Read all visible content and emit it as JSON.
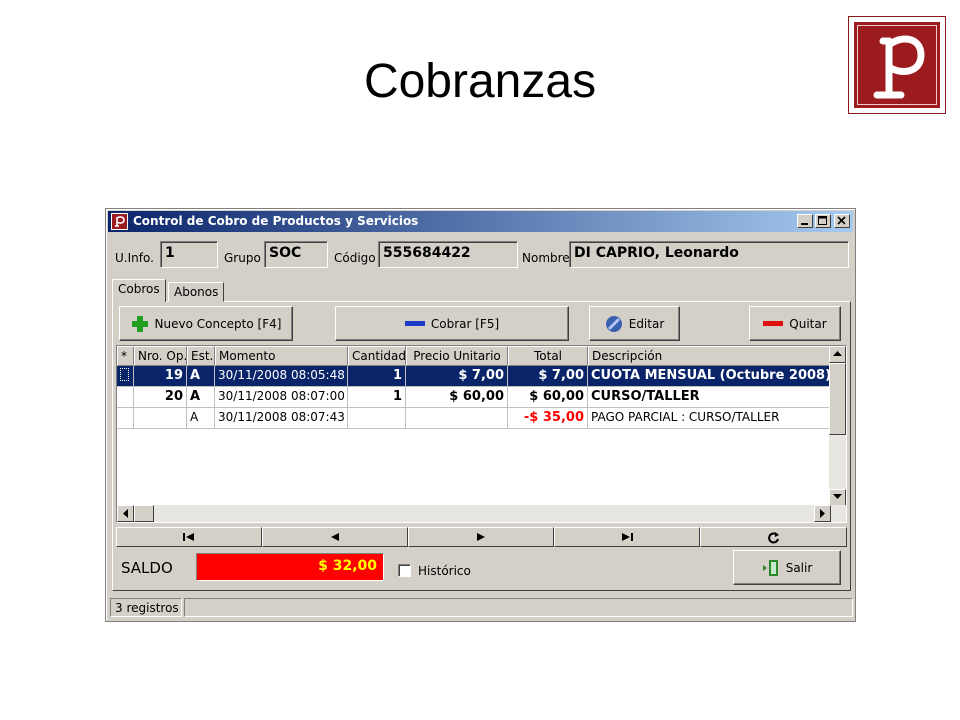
{
  "slide": {
    "title": "Cobranzas"
  },
  "window": {
    "title": "Control de Cobro de Productos y Servicios"
  },
  "header": {
    "uinfo_label": "U.Info.",
    "uinfo_value": "1",
    "grupo_label": "Grupo",
    "grupo_value": "SOC",
    "codigo_label": "Código",
    "codigo_value": "555684422",
    "nombre_label": "Nombre",
    "nombre_value": "DI CAPRIO, Leonardo"
  },
  "tabs": [
    {
      "label": "Cobros"
    },
    {
      "label": "Abonos"
    }
  ],
  "toolbar": {
    "nuevo": "Nuevo Concepto [F4]",
    "cobrar": "Cobrar [F5]",
    "editar": "Editar",
    "quitar": "Quitar"
  },
  "grid": {
    "columns": [
      "*",
      "Nro. Op.",
      "Est.",
      "Momento",
      "Cantidad",
      "Precio Unitario",
      "Total",
      "Descripción"
    ],
    "rows": [
      {
        "mark": "",
        "op": "19",
        "est": "A",
        "momento": "30/11/2008 08:05:48",
        "cantidad": "1",
        "precio": "$ 7,00",
        "total": "$ 7,00",
        "desc": "CUOTA MENSUAL (Octubre 2008)"
      },
      {
        "mark": "",
        "op": "20",
        "est": "A",
        "momento": "30/11/2008 08:07:00",
        "cantidad": "1",
        "precio": "$ 60,00",
        "total": "$ 60,00",
        "desc": "CURSO/TALLER"
      },
      {
        "mark": "",
        "op": "",
        "est": "A",
        "momento": "30/11/2008 08:07:43",
        "cantidad": "",
        "precio": "",
        "total": "-$ 35,00",
        "desc": "PAGO PARCIAL : CURSO/TALLER"
      }
    ]
  },
  "footer": {
    "saldo_label": "SALDO",
    "saldo_value": "$ 32,00",
    "historico_label": "Histórico",
    "salir": "Salir"
  },
  "status": {
    "registros": "3 registros"
  },
  "colors": {
    "titlebar": "#0a246a",
    "saldo_bg": "#ff0000",
    "saldo_text": "#ffff00",
    "negative": "#ff0000",
    "brand": "#9b1b1e"
  }
}
